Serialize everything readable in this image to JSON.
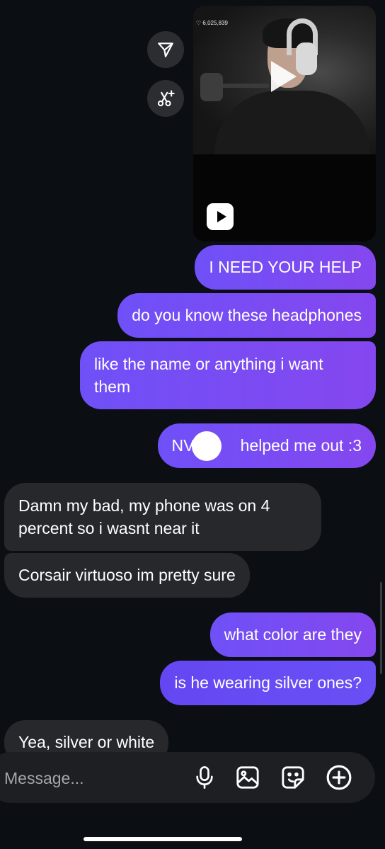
{
  "shared_reel": {
    "view_count": "♡ 6,025,839"
  },
  "messages": [
    {
      "id": "m1",
      "from": "me",
      "text": "I NEED YOUR HELP"
    },
    {
      "id": "m2",
      "from": "me",
      "text": "do you know these headphones"
    },
    {
      "id": "m3",
      "from": "me",
      "text": "like the name or anything i want them"
    },
    {
      "id": "m4",
      "from": "me",
      "text_before": "NVM",
      "text_after": "helped me out :3"
    },
    {
      "id": "r1",
      "from": "them",
      "text": "Damn my bad, my phone was on 4 percent so i wasnt near it"
    },
    {
      "id": "r2",
      "from": "them",
      "text": "Corsair virtuoso im pretty sure"
    },
    {
      "id": "m5",
      "from": "me",
      "text": "what color are they"
    },
    {
      "id": "m6",
      "from": "me",
      "text": "is he wearing silver ones?"
    },
    {
      "id": "r3",
      "from": "them",
      "text": "Yea, silver or white"
    }
  ],
  "composer": {
    "placeholder": "Message..."
  },
  "icons": {
    "share": "send-icon",
    "edit": "sparkle-scissors-icon",
    "play": "play-icon",
    "reel_badge": "reels-icon",
    "mic": "microphone-icon",
    "gallery": "image-icon",
    "sticker": "sticker-icon",
    "plus": "plus-circle-icon"
  },
  "colors": {
    "background": "#0b0e13",
    "sent_bubble": "#7b4cf3",
    "received_bubble": "#26282c"
  }
}
